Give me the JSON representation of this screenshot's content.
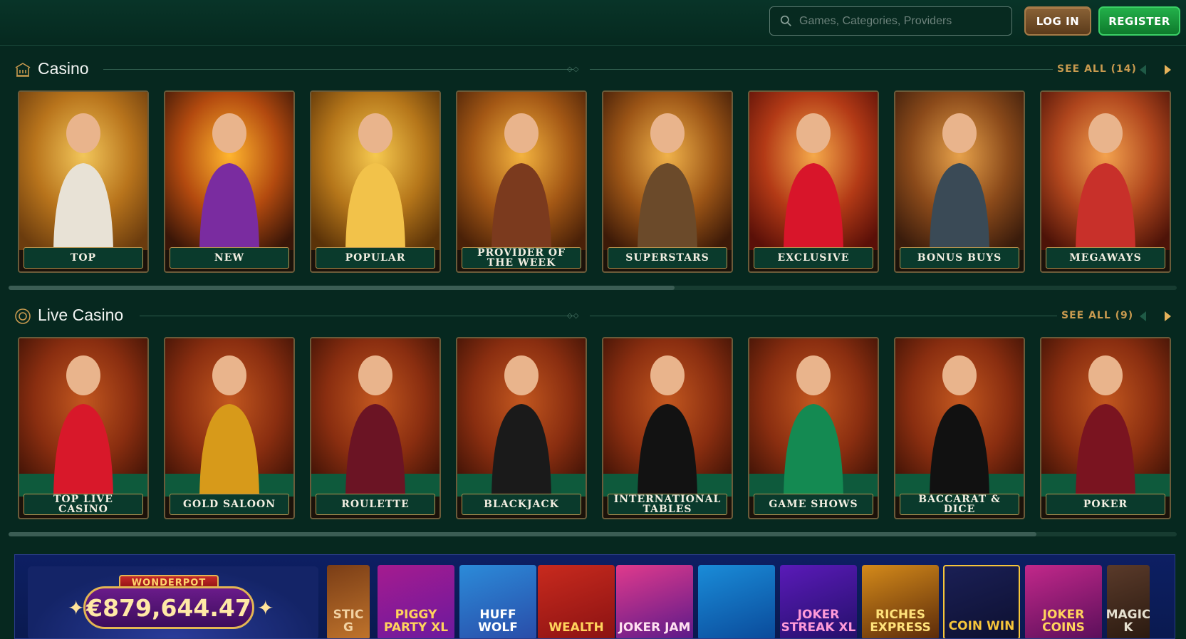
{
  "header": {
    "search_placeholder": "Games, Categories, Providers",
    "login_label": "LOG IN",
    "register_label": "REGISTER"
  },
  "casino": {
    "title": "Casino",
    "see_all": "SEE ALL (14)",
    "scroll_fraction": 0.57,
    "cards": [
      {
        "label": "TOP",
        "icon": "gods-illustration"
      },
      {
        "label": "NEW",
        "icon": "wizard-illustration"
      },
      {
        "label": "POPULAR",
        "icon": "fisherman-illustration"
      },
      {
        "label": "PROVIDER OF THE WEEK",
        "icon": "cowboy-illustration"
      },
      {
        "label": "SUPERSTARS",
        "icon": "jeweler-illustration"
      },
      {
        "label": "EXCLUSIVE",
        "icon": "ruby-gem-illustration"
      },
      {
        "label": "BONUS BUYS",
        "icon": "outlaws-illustration"
      },
      {
        "label": "MEGAWAYS",
        "icon": "couple-illustration"
      }
    ]
  },
  "live_casino": {
    "title": "Live Casino",
    "see_all": "SEE ALL (9)",
    "scroll_fraction": 0.88,
    "cards": [
      {
        "label": "TOP LIVE CASINO",
        "icon": "dealer-red-dress"
      },
      {
        "label": "GOLD SALOON",
        "icon": "dealer-yellow-dress"
      },
      {
        "label": "ROULETTE",
        "icon": "dealer-roulette"
      },
      {
        "label": "BLACKJACK",
        "icon": "dealer-bowtie"
      },
      {
        "label": "INTERNATIONAL TABLES",
        "icon": "dealer-chips"
      },
      {
        "label": "GAME SHOWS",
        "icon": "host-green-suit"
      },
      {
        "label": "BACCARAT & DICE",
        "icon": "dealer-black-dress"
      },
      {
        "label": "POKER",
        "icon": "dealer-cards"
      }
    ]
  },
  "promo": {
    "jackpot_title": "WONDERPOT",
    "jackpot_amount": "€879,644.47",
    "games": [
      {
        "title": "STIC G"
      },
      {
        "title": "PIGGY PARTY XL"
      },
      {
        "title": "HUFF WOLF"
      },
      {
        "title": "WEALTH"
      },
      {
        "title": "JOKER JAM"
      },
      {
        "title": ""
      },
      {
        "title": "JOKER STREAK XL"
      },
      {
        "title": "RICHES EXPRESS"
      },
      {
        "title": "COIN WIN"
      },
      {
        "title": "JOKER COINS"
      },
      {
        "title": "MAGIC K"
      }
    ]
  },
  "colors": {
    "background": "#06281f",
    "accent_gold": "#c89a4f",
    "login": "#8a6236",
    "register": "#23b04a"
  }
}
